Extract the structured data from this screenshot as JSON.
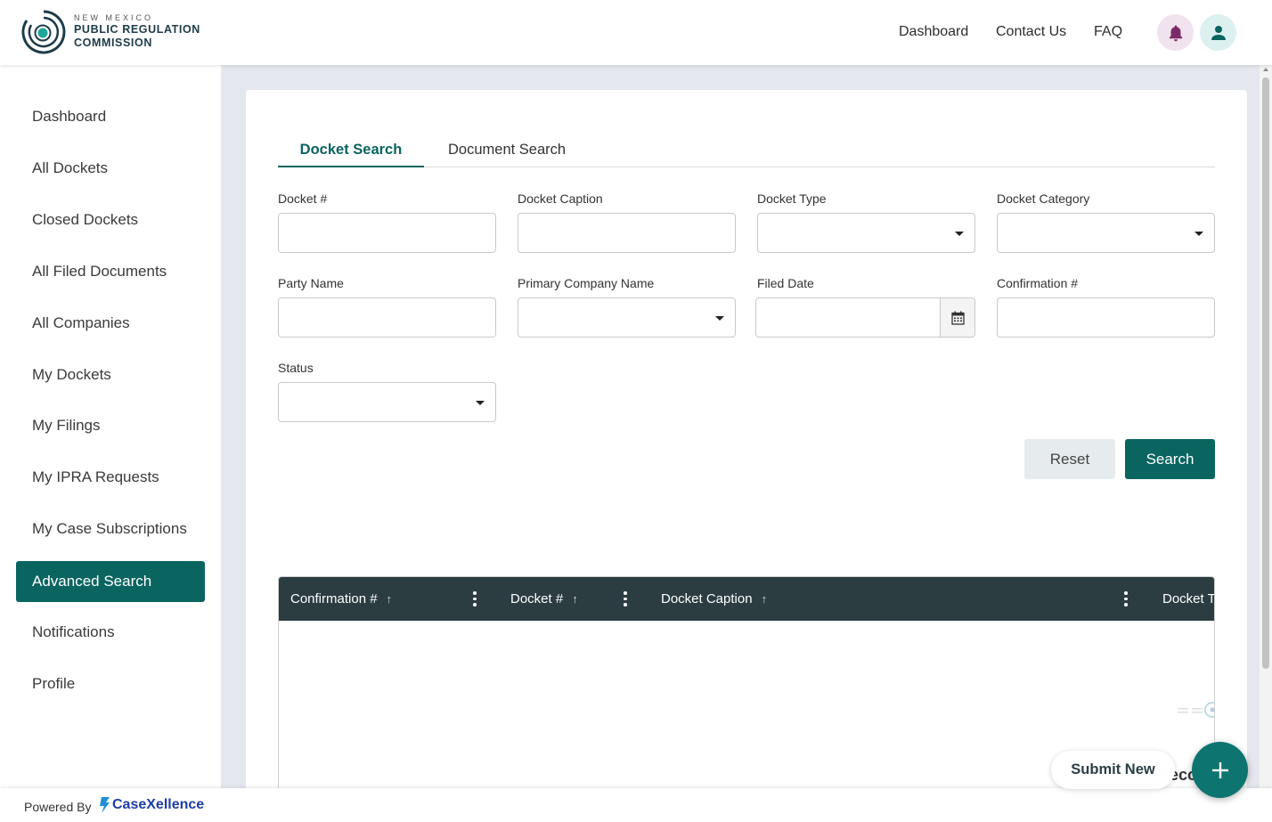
{
  "header": {
    "logo_line1": "NEW MEXICO",
    "logo_line2": "PUBLIC REGULATION",
    "logo_line3": "COMMISSION",
    "nav": [
      "Dashboard",
      "Contact Us",
      "FAQ"
    ],
    "icons": [
      "bell-icon",
      "user-icon"
    ]
  },
  "sidebar": {
    "items": [
      {
        "label": "Dashboard",
        "active": false
      },
      {
        "label": "All Dockets",
        "active": false
      },
      {
        "label": "Closed Dockets",
        "active": false
      },
      {
        "label": "All Filed Documents",
        "active": false
      },
      {
        "label": "All Companies",
        "active": false
      },
      {
        "label": "My Dockets",
        "active": false
      },
      {
        "label": "My Filings",
        "active": false
      },
      {
        "label": "My IPRA Requests",
        "active": false
      },
      {
        "label": "My Case Subscriptions",
        "active": false
      },
      {
        "label": "Advanced Search",
        "active": true
      },
      {
        "label": "Notifications",
        "active": false
      },
      {
        "label": "Profile",
        "active": false
      }
    ]
  },
  "tabs": [
    {
      "label": "Docket Search",
      "active": true
    },
    {
      "label": "Document Search",
      "active": false
    }
  ],
  "form": {
    "docket_no": {
      "label": "Docket #",
      "value": ""
    },
    "docket_caption": {
      "label": "Docket Caption",
      "value": ""
    },
    "docket_type": {
      "label": "Docket Type",
      "value": ""
    },
    "docket_category": {
      "label": "Docket Category",
      "value": ""
    },
    "party_name": {
      "label": "Party Name",
      "value": ""
    },
    "primary_company_name": {
      "label": "Primary Company Name",
      "value": ""
    },
    "filed_date": {
      "label": "Filed Date",
      "value": ""
    },
    "confirmation_no": {
      "label": "Confirmation #",
      "value": ""
    },
    "status": {
      "label": "Status",
      "value": ""
    },
    "reset_label": "Reset",
    "search_label": "Search"
  },
  "table": {
    "columns": [
      "Confirmation #",
      "Docket #",
      "Docket Caption",
      "Docket T"
    ],
    "rows": [],
    "peek_text": "eco"
  },
  "floating": {
    "submit_new_label": "Submit New",
    "fab_icon": "plus-icon"
  },
  "footer": {
    "powered_by": "Powered By",
    "brand_name": "CaseXellence"
  },
  "colors": {
    "accent": "#0a6460",
    "table_header": "#2c3d42",
    "main_background": "#e4e8ee",
    "brand_blue": "#1e3ea8"
  }
}
